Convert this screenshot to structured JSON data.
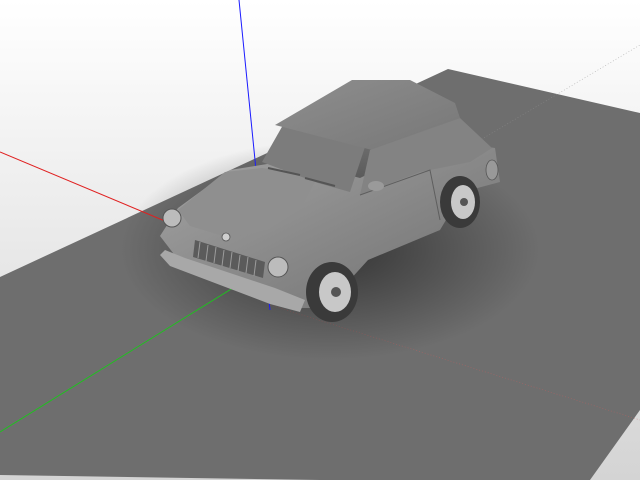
{
  "scene": {
    "background_top_color": "#ffffff",
    "background_bottom_color": "#d4d4d4",
    "ground_color": "#6e6e6e",
    "model_color": "#8a8a8a",
    "axes": {
      "x_color": "#e02020",
      "y_color": "#20c020",
      "z_color": "#1a1aff"
    }
  },
  "objects": {
    "model": {
      "icon": "car-icon",
      "description_visible": false
    }
  }
}
